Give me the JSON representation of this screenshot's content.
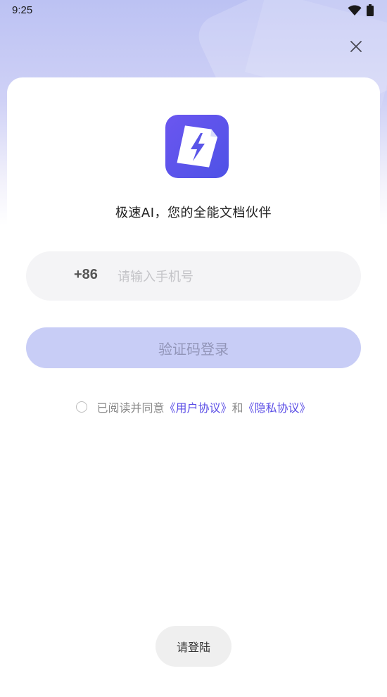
{
  "status_bar": {
    "time": "9:25",
    "wifi_icon": "wifi-icon",
    "battery_icon": "battery-icon"
  },
  "header": {
    "close_icon": "close-icon"
  },
  "app": {
    "logo_icon": "document-lightning-icon",
    "tagline": "极速AI，您的全能文档伙伴"
  },
  "login_form": {
    "country_code": "+86",
    "phone_placeholder": "请输入手机号",
    "phone_value": "",
    "login_button_label": "验证码登录"
  },
  "agreement": {
    "checked": false,
    "prefix": "已阅读并同意",
    "user_agreement": "《用户协议》",
    "connector": "和",
    "privacy_policy": "《隐私协议》"
  },
  "toast": {
    "message": "请登陆"
  },
  "colors": {
    "accent": "#5b4ee6",
    "button_disabled_bg": "#c8cdf6",
    "logo_gradient_start": "#6b56f0",
    "logo_gradient_end": "#4e52e6"
  }
}
